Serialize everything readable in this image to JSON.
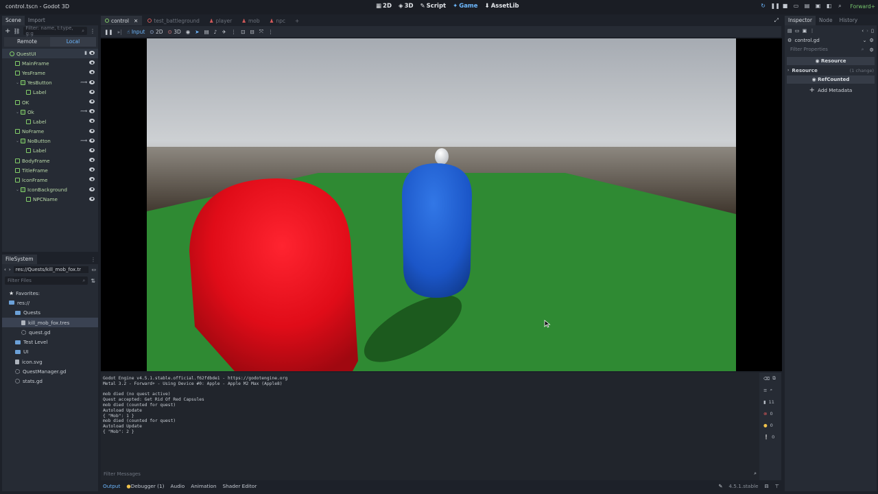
{
  "window": {
    "title": "control.tscn - Godot 3D",
    "renderer": "Forward+"
  },
  "main_modes": [
    {
      "label": "2D",
      "icon": "2d-icon",
      "active": false
    },
    {
      "label": "3D",
      "icon": "3d-icon",
      "active": false
    },
    {
      "label": "Script",
      "icon": "script-icon",
      "active": false
    },
    {
      "label": "Game",
      "icon": "game-icon",
      "active": true
    },
    {
      "label": "AssetLib",
      "icon": "assetlib-icon",
      "active": false
    }
  ],
  "scene_dock": {
    "tabs": [
      "Scene",
      "Import"
    ],
    "filter_placeholder": "Filter: name, t:type, g:g",
    "remote_label": "Remote",
    "local_label": "Local",
    "tree": [
      {
        "label": "QuestUI",
        "depth": 0
      },
      {
        "label": "MainFrame",
        "depth": 1
      },
      {
        "label": "YesFrame",
        "depth": 1
      },
      {
        "label": "YesButton",
        "depth": 2
      },
      {
        "label": "Label",
        "depth": 3
      },
      {
        "label": "OK",
        "depth": 1
      },
      {
        "label": "Ok",
        "depth": 2
      },
      {
        "label": "Label",
        "depth": 3
      },
      {
        "label": "NoFrame",
        "depth": 1
      },
      {
        "label": "NoButton",
        "depth": 2
      },
      {
        "label": "Label",
        "depth": 3
      },
      {
        "label": "BodyFrame",
        "depth": 1
      },
      {
        "label": "TitleFrame",
        "depth": 1
      },
      {
        "label": "IconFrame",
        "depth": 1
      },
      {
        "label": "IconBackground",
        "depth": 2
      },
      {
        "label": "NPCName",
        "depth": 3
      }
    ]
  },
  "filesystem": {
    "title": "FileSystem",
    "path": "res://Quests/kill_mob_fox.tr",
    "filter_placeholder": "Filter Files",
    "items": [
      {
        "label": "Favorites:",
        "kind": "favorites",
        "depth": 0
      },
      {
        "label": "res://",
        "kind": "folder",
        "depth": 0
      },
      {
        "label": "Quests",
        "kind": "folder",
        "depth": 1
      },
      {
        "label": "kill_mob_fox.tres",
        "kind": "file",
        "depth": 2
      },
      {
        "label": "quest.gd",
        "kind": "gear",
        "depth": 2
      },
      {
        "label": "Test Level",
        "kind": "folder",
        "depth": 1
      },
      {
        "label": "UI",
        "kind": "folder",
        "depth": 1
      },
      {
        "label": "icon.svg",
        "kind": "file",
        "depth": 1
      },
      {
        "label": "QuestManager.gd",
        "kind": "gear",
        "depth": 1
      },
      {
        "label": "stats.gd",
        "kind": "gear",
        "depth": 1
      }
    ]
  },
  "scene_tabs": [
    {
      "label": "control",
      "active": true
    },
    {
      "label": "test_battleground",
      "active": false
    },
    {
      "label": "player",
      "active": false
    },
    {
      "label": "mob",
      "active": false
    },
    {
      "label": "npc",
      "active": false
    }
  ],
  "game_toolbar": {
    "input_label": "Input",
    "label_2d": "2D",
    "label_3d": "3D"
  },
  "output": {
    "lines": [
      "Godot Engine v4.5.1.stable.official.f62fdbde1 - https://godotengine.org",
      "Metal 3.2 - Forward+ - Using Device #0: Apple - Apple M2 Max (Apple8)",
      "",
      "mob died (no quest active)",
      "Quest accepted: Get Rid Of Red Capsules",
      "mob died (counted for quest)",
      "Autoload Update",
      "{ \"Mob\": 1 }",
      "mob died (counted for quest)",
      "Autoload Update",
      "{ \"Mob\": 2 }"
    ],
    "filter_placeholder": "Filter Messages",
    "counts": {
      "messages": "11",
      "errors": "0",
      "warnings": "0",
      "editor": "0"
    }
  },
  "bottom_tabs": [
    "Output",
    "Debugger (1)",
    "Audio",
    "Animation",
    "Shader Editor"
  ],
  "version": "4.5.1.stable",
  "inspector": {
    "tabs": [
      "Inspector",
      "Node",
      "History"
    ],
    "file": "control.gd",
    "filter_placeholder": "Filter Properties",
    "resource_header": "Resource",
    "resource_label": "Resource",
    "resource_hint": "(1 change)",
    "refcounted": "RefCounted",
    "add_metadata": "Add Metadata"
  },
  "colors": {
    "accent": "#6db8ff",
    "node_green": "#84d06a",
    "ground": "#2f8a33",
    "red_capsule": "#e8101e",
    "blue_capsule": "#1f5fd6"
  }
}
